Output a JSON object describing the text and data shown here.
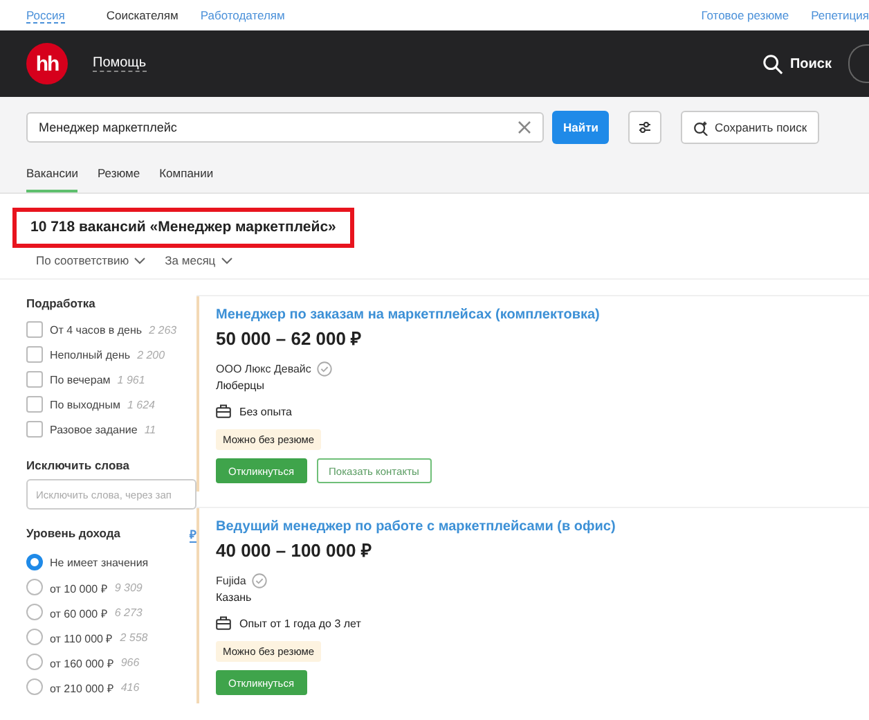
{
  "top_nav": {
    "region": "Россия",
    "left_links": [
      {
        "label": "Соискателям",
        "selected": true
      },
      {
        "label": "Работодателям",
        "selected": false
      }
    ],
    "right_links": [
      "Готовое резюме",
      "Репетиция"
    ]
  },
  "header": {
    "logo": "hh",
    "help": "Помощь",
    "search": "Поиск"
  },
  "search": {
    "value": "Менеджер маркетплейс",
    "button": "Найти",
    "save": "Сохранить поиск"
  },
  "tabs": [
    {
      "label": "Вакансии",
      "selected": true
    },
    {
      "label": "Резюме",
      "selected": false
    },
    {
      "label": "Компании",
      "selected": false
    }
  ],
  "results": {
    "headline": "10 718 вакансий «Менеджер маркетплейс»",
    "highlighted": true,
    "sort": [
      "По соответствию",
      "За месяц"
    ]
  },
  "filters": {
    "part_time": {
      "title": "Подработка",
      "options": [
        {
          "label": "От 4 часов в день",
          "count": "2 263",
          "checked": false
        },
        {
          "label": "Неполный день",
          "count": "2 200",
          "checked": false
        },
        {
          "label": "По вечерам",
          "count": "1 961",
          "checked": false
        },
        {
          "label": "По выходным",
          "count": "1 624",
          "checked": false
        },
        {
          "label": "Разовое задание",
          "count": "11",
          "checked": false
        }
      ]
    },
    "exclude": {
      "title": "Исключить слова",
      "placeholder": "Исключить слова, через зап"
    },
    "income": {
      "title": "Уровень дохода",
      "currency": "₽",
      "options": [
        {
          "label": "Не имеет значения",
          "selected": true
        },
        {
          "label": "от 10 000 ₽",
          "count": "9 309",
          "selected": false
        },
        {
          "label": "от 60 000 ₽",
          "count": "6 273",
          "selected": false
        },
        {
          "label": "от 110 000 ₽",
          "count": "2 558",
          "selected": false
        },
        {
          "label": "от 160 000 ₽",
          "count": "966",
          "selected": false
        },
        {
          "label": "от 210 000 ₽",
          "count": "416",
          "selected": false
        }
      ]
    }
  },
  "vacancies": [
    {
      "title": "Менеджер по заказам на маркетплейсах (комплектовка)",
      "salary": "50 000 – 62 000 ₽",
      "company": "ООО Люкс Девайс",
      "verified": true,
      "city": "Люберцы",
      "experience": "Без опыта",
      "tag": "Можно без резюме",
      "buttons": [
        {
          "label": "Откликнуться",
          "kind": "primary"
        },
        {
          "label": "Показать контакты",
          "kind": "outline"
        }
      ]
    },
    {
      "title": "Ведущий менеджер по работе с маркетплейсами (в офис)",
      "salary": "40 000 – 100 000 ₽",
      "company": "Fujida",
      "verified": true,
      "city": "Казань",
      "experience": "Опыт от 1 года до 3 лет",
      "tag": "Можно без резюме",
      "buttons": [
        {
          "label": "Откликнуться",
          "kind": "primary"
        }
      ]
    }
  ]
}
